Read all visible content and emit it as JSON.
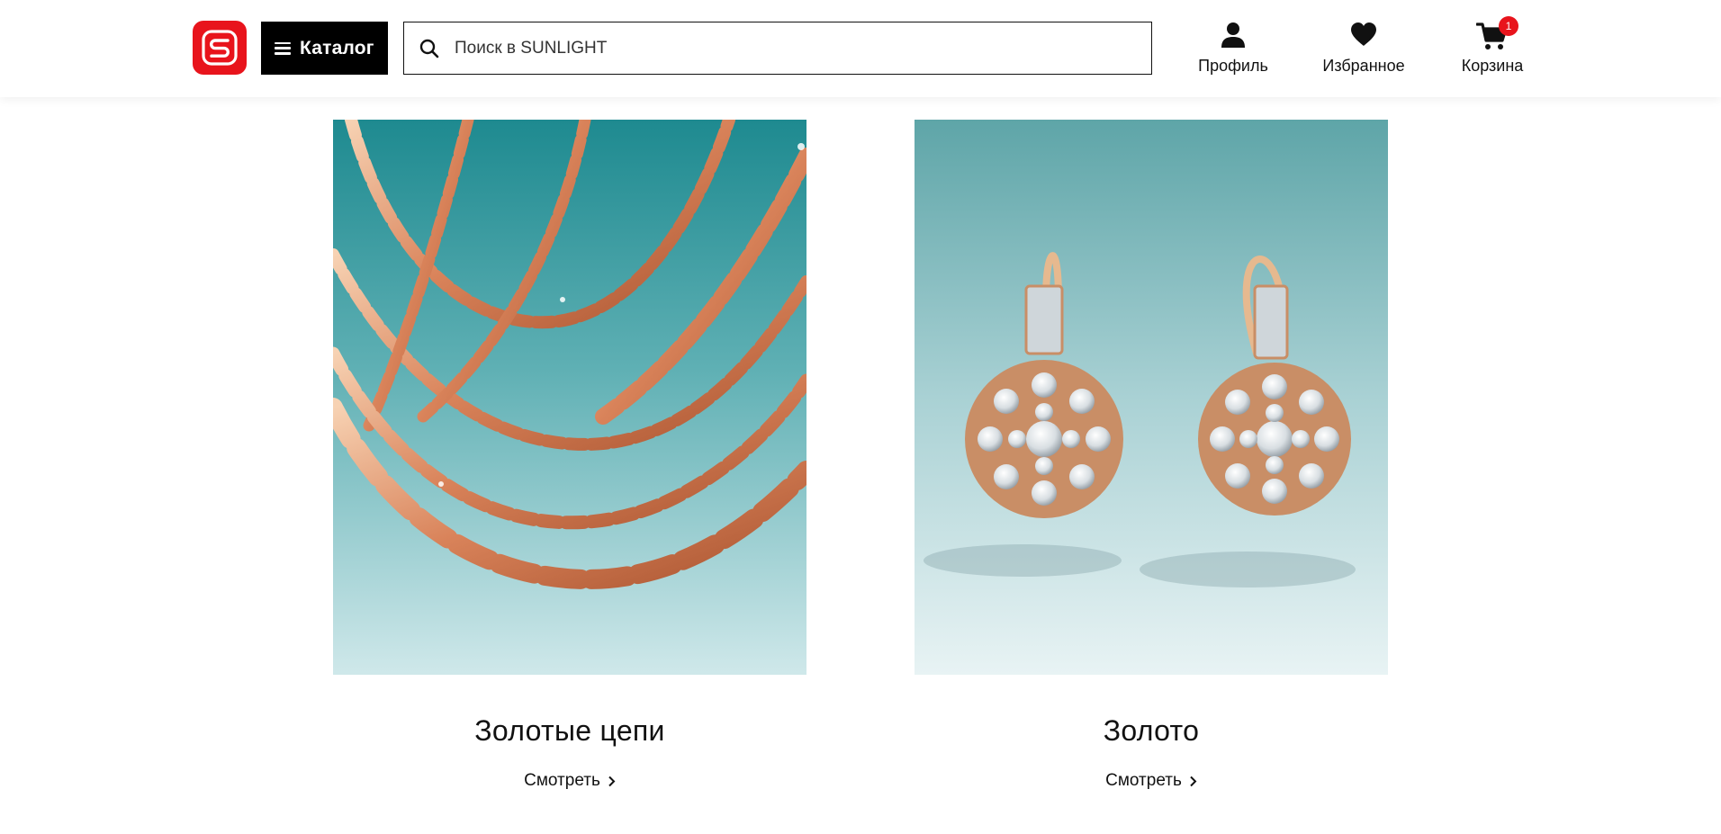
{
  "header": {
    "logo_text": "S",
    "catalog_label": "Каталог",
    "search_placeholder": "Поиск в SUNLIGHT",
    "profile_label": "Профиль",
    "favorites_label": "Избранное",
    "cart_label": "Корзина",
    "cart_count": "1",
    "brand_color": "#e8141c"
  },
  "cards": [
    {
      "title": "Золотые цепи",
      "link_label": "Смотреть",
      "image": "gold-chains-photo"
    },
    {
      "title": "Золото",
      "link_label": "Смотреть",
      "image": "gold-earrings-photo"
    }
  ],
  "icons": [
    "search-icon",
    "profile-icon",
    "heart-icon",
    "cart-icon",
    "menu-icon",
    "chevron-right-icon"
  ]
}
